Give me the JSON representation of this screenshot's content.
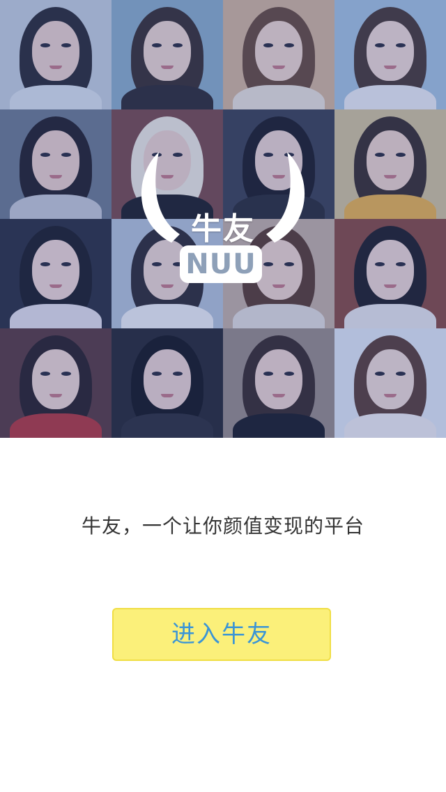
{
  "logo": {
    "name_cn": "牛友",
    "name_en": "NUU"
  },
  "slogan": "牛友，一个让你颜值变现的平台",
  "enter_button": {
    "label": "进入牛友"
  },
  "colors": {
    "button_bg": "#fbf07a",
    "button_border": "#f0de44",
    "button_text": "#3a95d6",
    "slogan_text": "#333333",
    "mosaic_tint": "#2846a0"
  },
  "photos": [
    {
      "bg": "#c9d3de",
      "hair": "#2b2a30",
      "face": "#f1d6cc",
      "shirt": "#dfe6ee"
    },
    {
      "bg": "#8fb0c8",
      "hair": "#3a2f2c",
      "face": "#f4dccf",
      "shirt": "#2f2a2e"
    },
    {
      "bg": "#d9b99a",
      "hair": "#6a4a36",
      "face": "#f6dccd",
      "shirt": "#efe6dc"
    },
    {
      "bg": "#a9c6e0",
      "hair": "#4a3830",
      "face": "#f6ded4",
      "shirt": "#f2f2f4"
    },
    {
      "bg": "#6f7c8e",
      "hair": "#231f24",
      "face": "#f2d5cb",
      "shirt": "#c9ccd6"
    },
    {
      "bg": "#7b4a48",
      "hair": "#f4efe2",
      "face": "#f3d7ce",
      "shirt": "#1e1e22"
    },
    {
      "bg": "#3c4150",
      "hair": "#1c1b20",
      "face": "#f1d8d0",
      "shirt": "#2a2b33"
    },
    {
      "bg": "#d7c79a",
      "hair": "#3a2d27",
      "face": "#f4d9cb",
      "shirt": "#f0b64a"
    },
    {
      "bg": "#2c2f3c",
      "hair": "#1d1c22",
      "face": "#f5dcd4",
      "shirt": "#e9e4ea"
    },
    {
      "bg": "#b9c7d8",
      "hair": "#2e2a2e",
      "face": "#f3dbd2",
      "shirt": "#f4f4f6"
    },
    {
      "bg": "#c8b3a4",
      "hair": "#5a3b2c",
      "face": "#f5dace",
      "shirt": "#e8e2de"
    },
    {
      "bg": "#8a4a3e",
      "hair": "#1f1c20",
      "face": "#f4dbd3",
      "shirt": "#eeeaec"
    },
    {
      "bg": "#5b3a3c",
      "hair": "#2a1f22",
      "face": "#f6dcd2",
      "shirt": "#b8363a"
    },
    {
      "bg": "#27272e",
      "hair": "#16161a",
      "face": "#f2d7d0",
      "shirt": "#2f2f36"
    },
    {
      "bg": "#9c8e86",
      "hair": "#3a2a26",
      "face": "#f4d9cf",
      "shirt": "#1b1b20"
    },
    {
      "bg": "#e8eef6",
      "hair": "#5c3e32",
      "face": "#f6e0d6",
      "shirt": "#f6f2f2"
    }
  ]
}
